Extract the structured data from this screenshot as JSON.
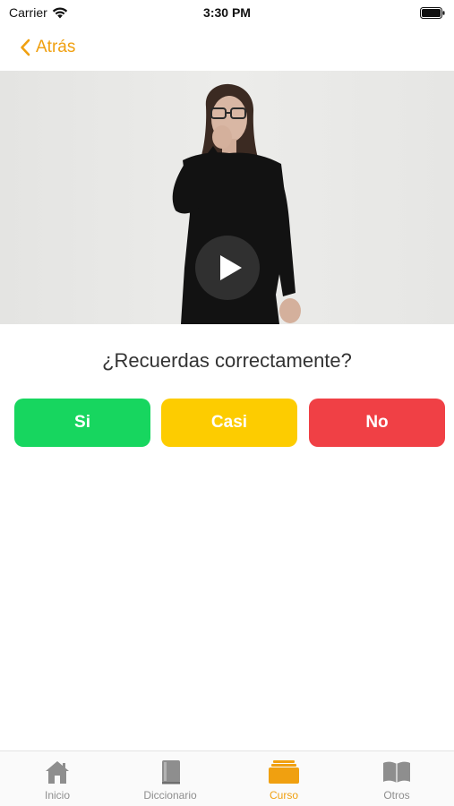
{
  "status_bar": {
    "carrier": "Carrier",
    "time": "3:30 PM"
  },
  "nav": {
    "back_label": "Atrás"
  },
  "question": "¿Recuerdas correctamente?",
  "answers": [
    {
      "label": "Si",
      "color": "#17d65f"
    },
    {
      "label": "Casi",
      "color": "#fdcc00"
    },
    {
      "label": "No",
      "color": "#f04045"
    }
  ],
  "tabs": [
    {
      "label": "Inicio",
      "icon": "house-icon",
      "active": false
    },
    {
      "label": "Diccionario",
      "icon": "book-icon",
      "active": false
    },
    {
      "label": "Curso",
      "icon": "stack-icon",
      "active": true
    },
    {
      "label": "Otros",
      "icon": "open-book-icon",
      "active": false
    }
  ],
  "colors": {
    "accent": "#f0a010",
    "inactive": "#8e8e8e"
  }
}
